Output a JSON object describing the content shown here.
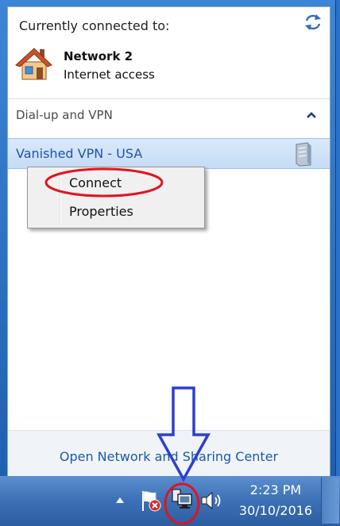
{
  "header": {
    "title": "Currently connected to:"
  },
  "network": {
    "name": "Network  2",
    "status": "Internet access"
  },
  "section": {
    "label": "Dial-up and VPN"
  },
  "vpn": {
    "label": "Vanished VPN - USA"
  },
  "context_menu": {
    "items": [
      "Connect",
      "Properties"
    ]
  },
  "footer": {
    "link": "Open Network and Sharing Center"
  },
  "taskbar": {
    "time": "2:23 PM",
    "date": "30/10/2016"
  },
  "annotations": {
    "circle_color": "#e0141e",
    "arrow_color": "#2d3fd0"
  }
}
